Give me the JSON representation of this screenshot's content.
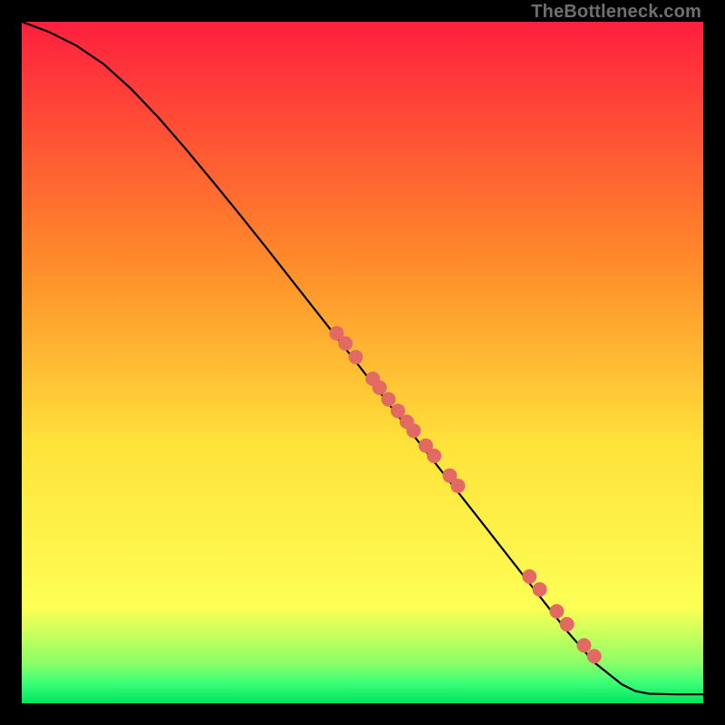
{
  "watermark": "TheBottleneck.com",
  "colors": {
    "gradient_top": "#ff1f3e",
    "gradient_mid_upper": "#ff8a2a",
    "gradient_mid": "#ffe23a",
    "gradient_mid_lower": "#fdff55",
    "gradient_green1": "#8dff66",
    "gradient_green2": "#3cff77",
    "gradient_bottom": "#00e45e",
    "line": "#000000",
    "marker": "#e26a63",
    "frame": "#000000"
  },
  "chart_data": {
    "type": "line",
    "title": "",
    "xlabel": "",
    "ylabel": "",
    "xlim": [
      0,
      100
    ],
    "ylim": [
      0,
      100
    ],
    "series": [
      {
        "name": "curve",
        "x": [
          0,
          4,
          8,
          12,
          16,
          20,
          24,
          28,
          32,
          36,
          40,
          44,
          48,
          52,
          56,
          60,
          64,
          68,
          72,
          76,
          80,
          84,
          88,
          90,
          92,
          96,
          100
        ],
        "y": [
          100,
          98.5,
          96.5,
          93.8,
          90.2,
          86.0,
          81.4,
          76.6,
          71.7,
          66.7,
          61.6,
          56.5,
          51.4,
          46.3,
          41.2,
          36.1,
          31.0,
          25.9,
          20.8,
          15.7,
          10.6,
          6.0,
          2.8,
          1.8,
          1.4,
          1.3,
          1.3
        ]
      }
    ],
    "markers": [
      {
        "x": 46.2,
        "y": 54.3
      },
      {
        "x": 47.5,
        "y": 52.8
      },
      {
        "x": 49.0,
        "y": 50.8
      },
      {
        "x": 51.5,
        "y": 47.6
      },
      {
        "x": 52.5,
        "y": 46.3
      },
      {
        "x": 53.8,
        "y": 44.6
      },
      {
        "x": 55.2,
        "y": 42.9
      },
      {
        "x": 56.5,
        "y": 41.3
      },
      {
        "x": 57.5,
        "y": 40.0
      },
      {
        "x": 59.3,
        "y": 37.8
      },
      {
        "x": 60.5,
        "y": 36.3
      },
      {
        "x": 62.8,
        "y": 33.4
      },
      {
        "x": 64.0,
        "y": 31.9
      },
      {
        "x": 74.5,
        "y": 18.6
      },
      {
        "x": 76.0,
        "y": 16.7
      },
      {
        "x": 78.5,
        "y": 13.5
      },
      {
        "x": 80.0,
        "y": 11.6
      },
      {
        "x": 82.5,
        "y": 8.5
      },
      {
        "x": 84.0,
        "y": 6.9
      }
    ]
  }
}
